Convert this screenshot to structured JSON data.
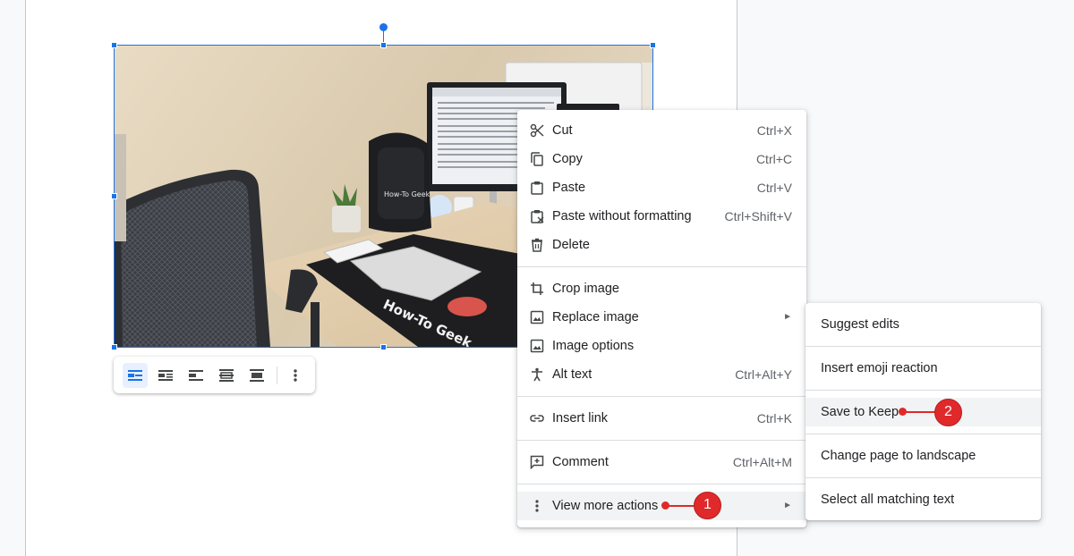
{
  "image": {
    "alt_text": "How-To Geek",
    "bag_text": "How-To Geek",
    "mat_text": "How-To Geek"
  },
  "image_toolbar": {
    "buttons": [
      {
        "name": "inline-icon",
        "active": true
      },
      {
        "name": "wrap-text-icon",
        "active": false
      },
      {
        "name": "break-text-icon",
        "active": false
      },
      {
        "name": "behind-text-icon",
        "active": false
      },
      {
        "name": "in-front-of-text-icon",
        "active": false
      }
    ],
    "more_icon": "more-vert-icon"
  },
  "context_menu": {
    "items": [
      {
        "label": "Cut",
        "shortcut": "Ctrl+X",
        "icon": "scissors-icon"
      },
      {
        "label": "Copy",
        "shortcut": "Ctrl+C",
        "icon": "copy-icon"
      },
      {
        "label": "Paste",
        "shortcut": "Ctrl+V",
        "icon": "paste-icon"
      },
      {
        "label": "Paste without formatting",
        "shortcut": "Ctrl+Shift+V",
        "icon": "paste-plain-icon"
      },
      {
        "label": "Delete",
        "shortcut": "",
        "icon": "trash-icon"
      },
      {
        "label": "Crop image",
        "shortcut": "",
        "icon": "crop-icon"
      },
      {
        "label": "Replace image",
        "shortcut": "",
        "icon": "image-icon",
        "submenu_arrow": "►"
      },
      {
        "label": "Image options",
        "shortcut": "",
        "icon": "image-icon"
      },
      {
        "label": "Alt text",
        "shortcut": "Ctrl+Alt+Y",
        "icon": "accessibility-icon"
      },
      {
        "label": "Insert link",
        "shortcut": "Ctrl+K",
        "icon": "link-icon"
      },
      {
        "label": "Comment",
        "shortcut": "Ctrl+Alt+M",
        "icon": "add-comment-icon"
      },
      {
        "label": "View more actions",
        "shortcut": "",
        "icon": "more-vert-icon",
        "submenu_arrow": "►"
      }
    ]
  },
  "submenu": {
    "items": [
      {
        "label": "Suggest edits"
      },
      {
        "label": "Insert emoji reaction"
      },
      {
        "label": "Save to Keep"
      },
      {
        "label": "Change page to landscape"
      },
      {
        "label": "Select all matching text"
      }
    ]
  },
  "annotations": {
    "step1": "1",
    "step2": "2",
    "color": "#e0292b"
  },
  "colors": {
    "selection": "#1a73e8",
    "menu_highlight": "#f1f3f4",
    "toolbar_active": "#e8f0fe"
  }
}
